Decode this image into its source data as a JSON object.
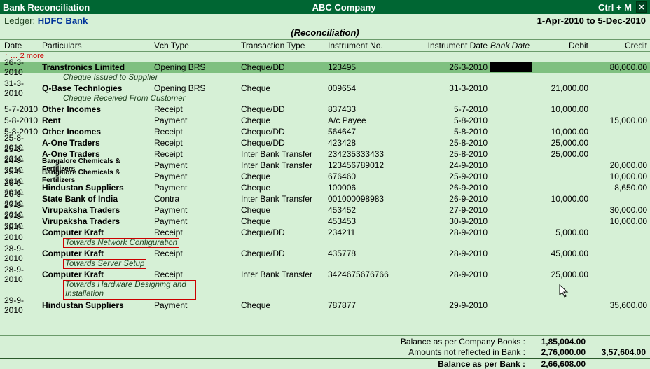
{
  "titlebar": {
    "left": "Bank Reconciliation",
    "center": "ABC Company",
    "shortcut": "Ctrl + M",
    "close": "✕"
  },
  "subheader": {
    "ledger_label": "Ledger:",
    "ledger_name": "HDFC Bank",
    "period": "1-Apr-2010 to 5-Dec-2010"
  },
  "recon_title": "(Reconciliation)",
  "columns": {
    "date": "Date",
    "particulars": "Particulars",
    "vch": "Vch Type",
    "ttype": "Transaction Type",
    "instno": "Instrument No.",
    "idate": "Instrument Date",
    "bdate": "Bank Date",
    "debit": "Debit",
    "credit": "Credit"
  },
  "more_hint": "↑ … 2 more",
  "rows": [
    {
      "date": "26-3-2010",
      "part": "Transtronics Limited",
      "vch": "Opening BRS",
      "ttype": "Cheque/DD",
      "instno": "123495",
      "idate": "26-3-2010",
      "bdate_black": true,
      "credit": "80,000.00",
      "selected": true
    },
    {
      "narr": "Cheque Issued to Supplier"
    },
    {
      "date": "31-3-2010",
      "part": "Q-Base Technlogies",
      "vch": "Opening BRS",
      "ttype": "Cheque",
      "instno": "009654",
      "idate": "31-3-2010",
      "debit": "21,000.00"
    },
    {
      "narr": "Cheque Received From Customer"
    },
    {
      "date": "5-7-2010",
      "part": "Other Incomes",
      "vch": "Receipt",
      "ttype": "Cheque/DD",
      "instno": "837433",
      "idate": "5-7-2010",
      "debit": "10,000.00"
    },
    {
      "date": "5-8-2010",
      "part": "Rent",
      "vch": "Payment",
      "ttype": "Cheque",
      "instno": "A/c Payee",
      "idate": "5-8-2010",
      "credit": "15,000.00"
    },
    {
      "date": "5-8-2010",
      "part": "Other Incomes",
      "vch": "Receipt",
      "ttype": "Cheque/DD",
      "instno": "564647",
      "idate": "5-8-2010",
      "debit": "10,000.00"
    },
    {
      "date": "25-8-2010",
      "part": "A-One Traders",
      "vch": "Receipt",
      "ttype": "Cheque/DD",
      "instno": "423428",
      "idate": "25-8-2010",
      "debit": "25,000.00"
    },
    {
      "date": "25-8-2010",
      "part": "A-One Traders",
      "vch": "Receipt",
      "ttype": "Inter Bank Transfer",
      "instno": "234235333433",
      "idate": "25-8-2010",
      "debit": "25,000.00"
    },
    {
      "date": "24-9-2010",
      "part": "Bangalore Chemicals & Fertilizers",
      "small": true,
      "vch": "Payment",
      "ttype": "Inter Bank Transfer",
      "instno": "123456789012",
      "idate": "24-9-2010",
      "credit": "20,000.00"
    },
    {
      "date": "25-9-2010",
      "part": "Bangalore Chemicals & Fertilizers",
      "small": true,
      "vch": "Payment",
      "ttype": "Cheque",
      "instno": "676460",
      "idate": "25-9-2010",
      "credit": "10,000.00"
    },
    {
      "date": "26-9-2010",
      "part": "Hindustan Suppliers",
      "vch": "Payment",
      "ttype": "Cheque",
      "instno": "100006",
      "idate": "26-9-2010",
      "credit": "8,650.00"
    },
    {
      "date": "26-9-2010",
      "part": "State Bank of India",
      "vch": "Contra",
      "ttype": "Inter Bank Transfer",
      "instno": "001000098983",
      "idate": "26-9-2010",
      "debit": "10,000.00"
    },
    {
      "date": "27-9-2010",
      "part": "Virupaksha Traders",
      "vch": "Payment",
      "ttype": "Cheque",
      "instno": "453452",
      "idate": "27-9-2010",
      "credit": "30,000.00"
    },
    {
      "date": "27-9-2010",
      "part": "Virupaksha Traders",
      "vch": "Payment",
      "ttype": "Cheque",
      "instno": "453453",
      "idate": "30-9-2010",
      "credit": "10,000.00"
    },
    {
      "date": "28-9-2010",
      "part": "Computer Kraft",
      "vch": "Receipt",
      "ttype": "Cheque/DD",
      "instno": "234211",
      "idate": "28-9-2010",
      "debit": "5,000.00"
    },
    {
      "narr": "Towards Network Configuration",
      "boxed": true
    },
    {
      "date": "28-9-2010",
      "part": "Computer Kraft",
      "vch": "Receipt",
      "ttype": "Cheque/DD",
      "instno": "435778",
      "idate": "28-9-2010",
      "debit": "45,000.00"
    },
    {
      "narr": "Towards Server Setup",
      "boxed": true
    },
    {
      "date": "28-9-2010",
      "part": "Computer Kraft",
      "vch": "Receipt",
      "ttype": "Inter Bank Transfer",
      "instno": "3424675676766",
      "idate": "28-9-2010",
      "debit": "25,000.00"
    },
    {
      "narr": "Towards Hardware Designing and Installation",
      "boxed": true,
      "multi": true
    },
    {
      "date": "29-9-2010",
      "part": "Hindustan Suppliers",
      "vch": "Payment",
      "ttype": "Cheque",
      "instno": "787877",
      "idate": "29-9-2010",
      "credit": "35,600.00"
    }
  ],
  "footer": {
    "l1": {
      "lbl": "Balance as per Company Books :",
      "d": "1,85,004.00",
      "c": ""
    },
    "l2": {
      "lbl": "Amounts not reflected in Bank :",
      "d": "2,76,000.00",
      "c": "3,57,604.00"
    },
    "l3": {
      "lbl": "Balance as per Bank :",
      "d": "2,66,608.00",
      "c": ""
    }
  }
}
